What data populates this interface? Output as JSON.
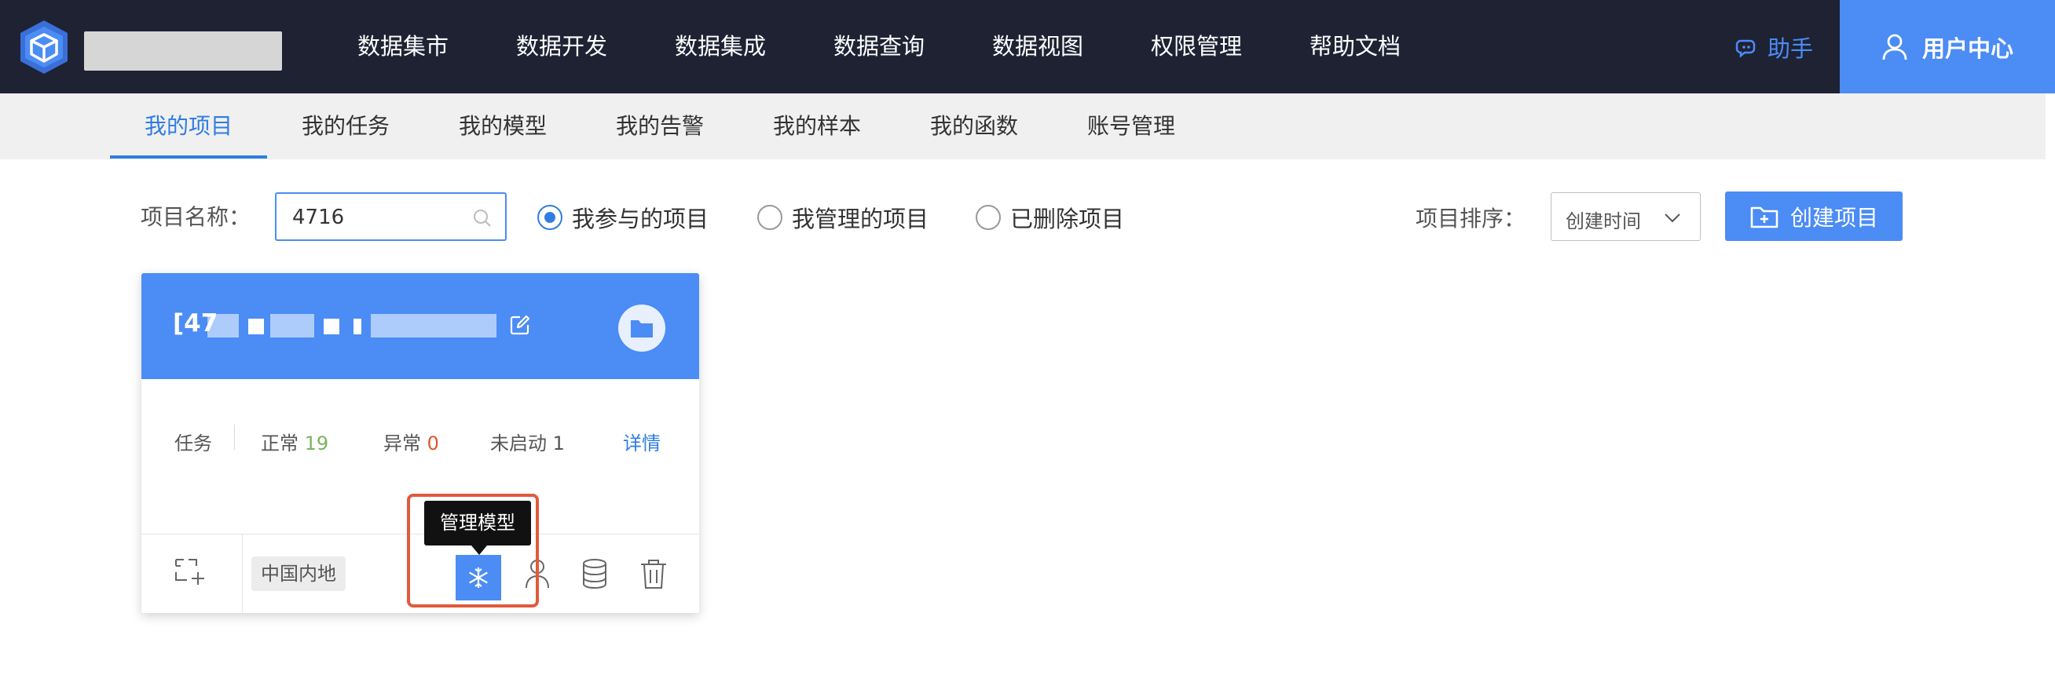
{
  "app": {
    "nav": [
      "数据集市",
      "数据开发",
      "数据集成",
      "数据查询",
      "数据视图",
      "权限管理",
      "帮助文档"
    ],
    "assistant_label": "助手",
    "user_center_label": "用户中心"
  },
  "tabs": [
    "我的项目",
    "我的任务",
    "我的模型",
    "我的告警",
    "我的样本",
    "我的函数",
    "账号管理"
  ],
  "active_tab": "我的项目",
  "filter": {
    "name_label": "项目名称：",
    "search_value": "4716",
    "radios": [
      {
        "label": "我参与的项目",
        "checked": true
      },
      {
        "label": "我管理的项目",
        "checked": false
      },
      {
        "label": "已删除项目",
        "checked": false
      }
    ],
    "sort_label": "项目排序：",
    "sort_value": "创建时间",
    "create_label": "创建项目"
  },
  "card": {
    "title_prefix": "[47",
    "stats": {
      "task_label": "任务",
      "normal_label": "正常",
      "normal_count": "19",
      "abnormal_label": "异常",
      "abnormal_count": "0",
      "inactive_label": "未启动",
      "inactive_count": "1",
      "detail_label": "详情"
    },
    "region": "中国内地",
    "tooltip": "管理模型"
  },
  "colors": {
    "topbar": "#1e2233",
    "accent": "#4b8cf5",
    "highlight": "#e05a3c"
  }
}
